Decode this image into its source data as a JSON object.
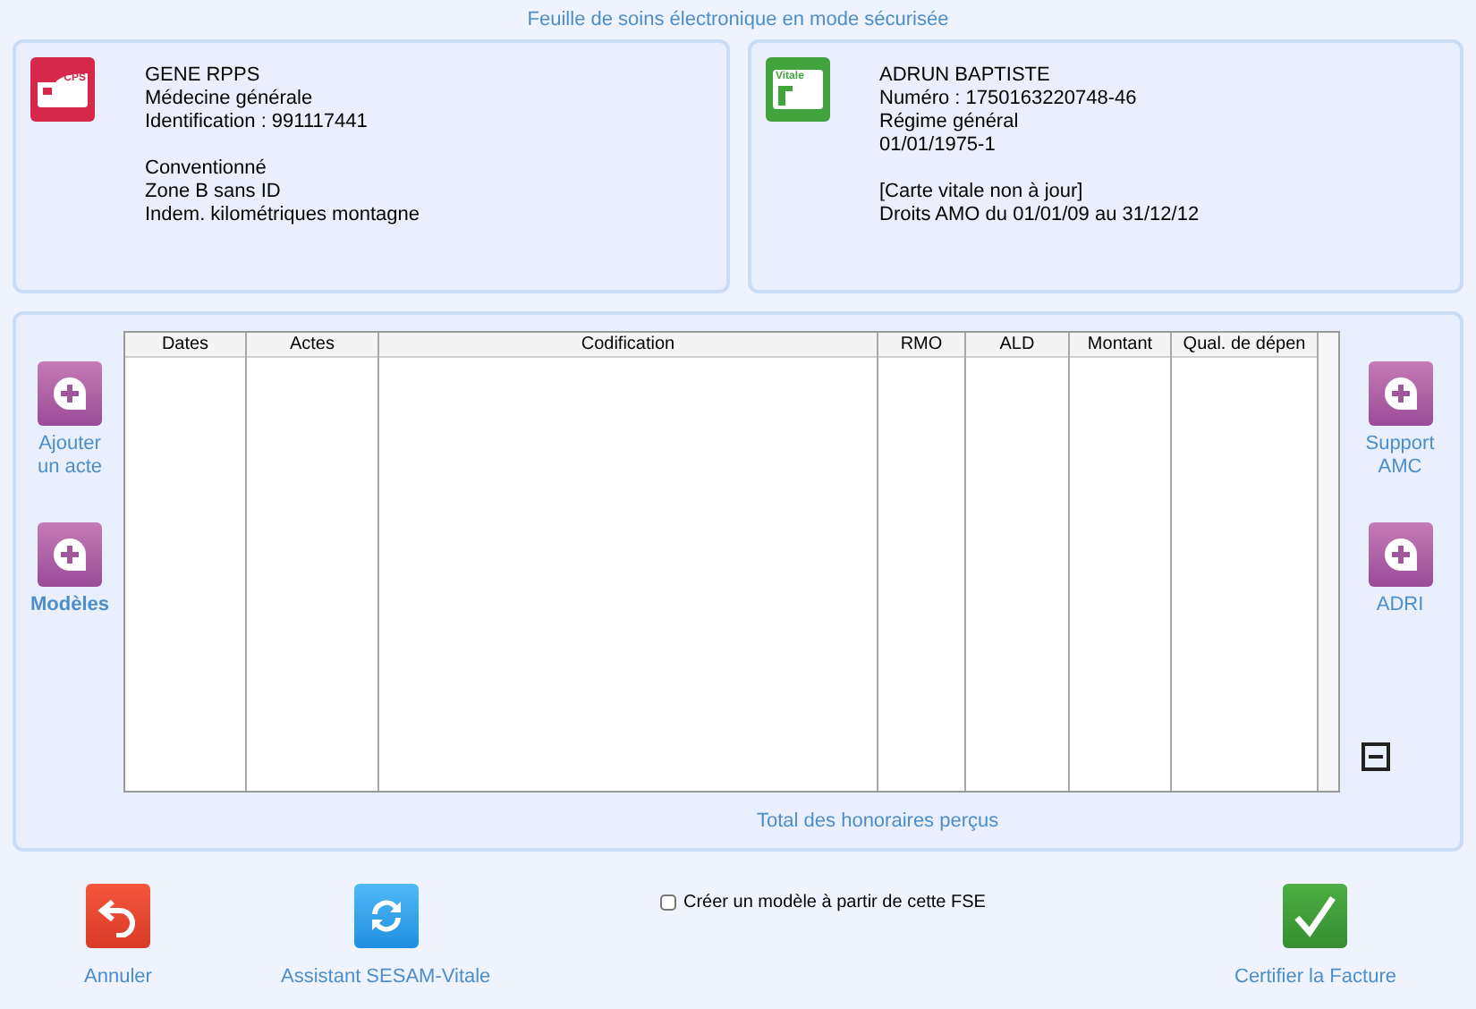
{
  "title": "Feuille de soins électronique en mode sécurisée",
  "cards": [
    {
      "kind": "cps",
      "badge": "CPS",
      "groups": [
        [
          "GENE RPPS",
          "Médecine générale",
          "Identification : 991117441"
        ],
        [
          "Conventionné",
          "Zone B sans ID",
          "Indem. kilométriques montagne"
        ]
      ]
    },
    {
      "kind": "vitale",
      "badge": "Vitale",
      "groups": [
        [
          "ADRUN BAPTISTE",
          "Numéro : 1750163220748-46",
          "Régime général",
          "01/01/1975-1"
        ],
        [
          "[Carte vitale non à jour]",
          "Droits AMO du 01/01/09 au 31/12/12"
        ]
      ]
    }
  ],
  "left_actions": [
    {
      "label": "Ajouter un acte",
      "bold": false
    },
    {
      "label": "Modèles",
      "bold": true
    }
  ],
  "right_actions": [
    {
      "label": "Support AMC",
      "bold": false
    },
    {
      "label": "ADRI",
      "bold": false
    }
  ],
  "table": {
    "columns": [
      "Dates",
      "Actes",
      "Codification",
      "RMO",
      "ALD",
      "Montant",
      "Qual. de dépen"
    ]
  },
  "total_label": "Total des honoraires perçus",
  "template_checkbox": {
    "label": "Créer un modèle à partir de cette FSE",
    "checked": false
  },
  "buttons": [
    {
      "kind": "undo",
      "label": "Annuler"
    },
    {
      "kind": "refresh",
      "label": "Assistant SESAM-Vitale"
    },
    {
      "kind": "check",
      "label": "Certifier la Facture"
    }
  ]
}
